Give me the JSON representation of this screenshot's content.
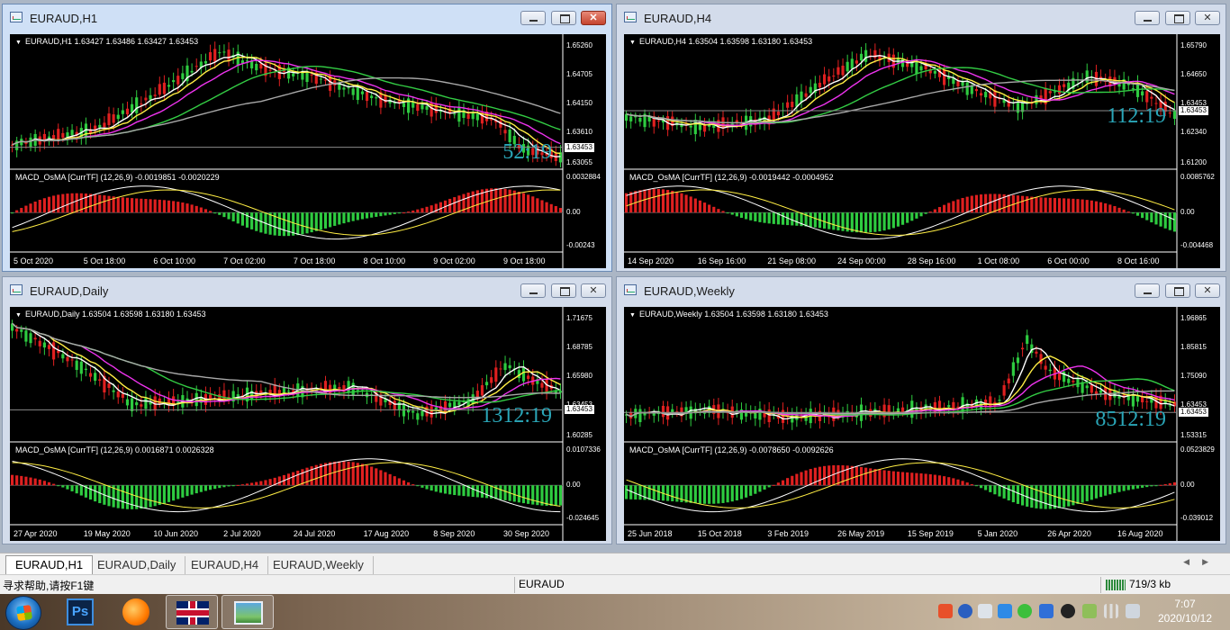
{
  "windows": [
    {
      "id": "h1",
      "title": "EURAUD,H1",
      "symbol_line": "EURAUD,H1  1.63427 1.63486 1.63427 1.63453",
      "indicator_line": "MACD_OsMA [CurrTF] (12,26,9) -0.0019851 -0.0020229",
      "timer": "52:19",
      "price_labels": [
        "1.65260",
        "1.64705",
        "1.64150",
        "1.63610",
        "1.63055"
      ],
      "current_price": "1.63453",
      "macd_labels": [
        "0.0032884",
        "0.00",
        "-0.00243"
      ],
      "dates": [
        "5 Oct 2020",
        "5 Oct 18:00",
        "6 Oct 10:00",
        "7 Oct 02:00",
        "7 Oct 18:00",
        "8 Oct 10:00",
        "9 Oct 02:00",
        "9 Oct 18:00"
      ]
    },
    {
      "id": "h4",
      "title": "EURAUD,H4",
      "symbol_line": "EURAUD,H4  1.63504 1.63598 1.63180 1.63453",
      "indicator_line": "MACD_OsMA [CurrTF] (12,26,9) -0.0019442 -0.0004952",
      "timer": "112:19",
      "price_labels": [
        "1.65790",
        "1.64650",
        "1.63453",
        "1.62340",
        "1.61200"
      ],
      "current_price": "1.63453",
      "macd_labels": [
        "0.0085762",
        "0.00",
        "-0.004468"
      ],
      "dates": [
        "14 Sep 2020",
        "16 Sep 16:00",
        "21 Sep 08:00",
        "24 Sep 00:00",
        "28 Sep 16:00",
        "1 Oct 08:00",
        "6 Oct 00:00",
        "8 Oct 16:00"
      ]
    },
    {
      "id": "daily",
      "title": "EURAUD,Daily",
      "symbol_line": "EURAUD,Daily  1.63504 1.63598 1.63180 1.63453",
      "indicator_line": "MACD_OsMA [CurrTF] (12,26,9) 0.0016871 0.0026328",
      "timer": "1312:19",
      "price_labels": [
        "1.71675",
        "1.68785",
        "1.65980",
        "1.63453",
        "1.60285"
      ],
      "current_price": "1.63453",
      "macd_labels": [
        "0.0107336",
        "0.00",
        "-0.024645"
      ],
      "dates": [
        "27 Apr 2020",
        "19 May 2020",
        "10 Jun 2020",
        "2 Jul 2020",
        "24 Jul 2020",
        "17 Aug 2020",
        "8 Sep 2020",
        "30 Sep 2020"
      ]
    },
    {
      "id": "weekly",
      "title": "EURAUD,Weekly",
      "symbol_line": "EURAUD,Weekly  1.63504 1.63598 1.63180 1.63453",
      "indicator_line": "MACD_OsMA [CurrTF] (12,26,9) -0.0078650 -0.0092626",
      "timer": "8512:19",
      "price_labels": [
        "1.96865",
        "1.85815",
        "1.75090",
        "1.63453",
        "1.53315"
      ],
      "current_price": "1.63453",
      "macd_labels": [
        "0.0523829",
        "0.00",
        "-0.039012"
      ],
      "dates": [
        "25 Jun 2018",
        "15 Oct 2018",
        "3 Feb 2019",
        "26 May 2019",
        "15 Sep 2019",
        "5 Jan 2020",
        "26 Apr 2020",
        "16 Aug 2020"
      ]
    }
  ],
  "tabs": [
    "EURAUD,H1",
    "EURAUD,Daily",
    "EURAUD,H4",
    "EURAUD,Weekly"
  ],
  "status": {
    "help": "寻求帮助,请按F1键",
    "symbol": "EURAUD",
    "traffic": "719/3 kb"
  },
  "clock": {
    "time": "7:07",
    "date": "2020/10/12"
  },
  "colors": {
    "bull": "#2ecc40",
    "bear": "#e02020",
    "ma_white": "#ffffff",
    "ma_yellow": "#ffee44",
    "ma_magenta": "#ee33ee",
    "ma_green": "#33cc44",
    "ma_gray": "#a8a8a8",
    "timer": "#2aa6b8"
  }
}
